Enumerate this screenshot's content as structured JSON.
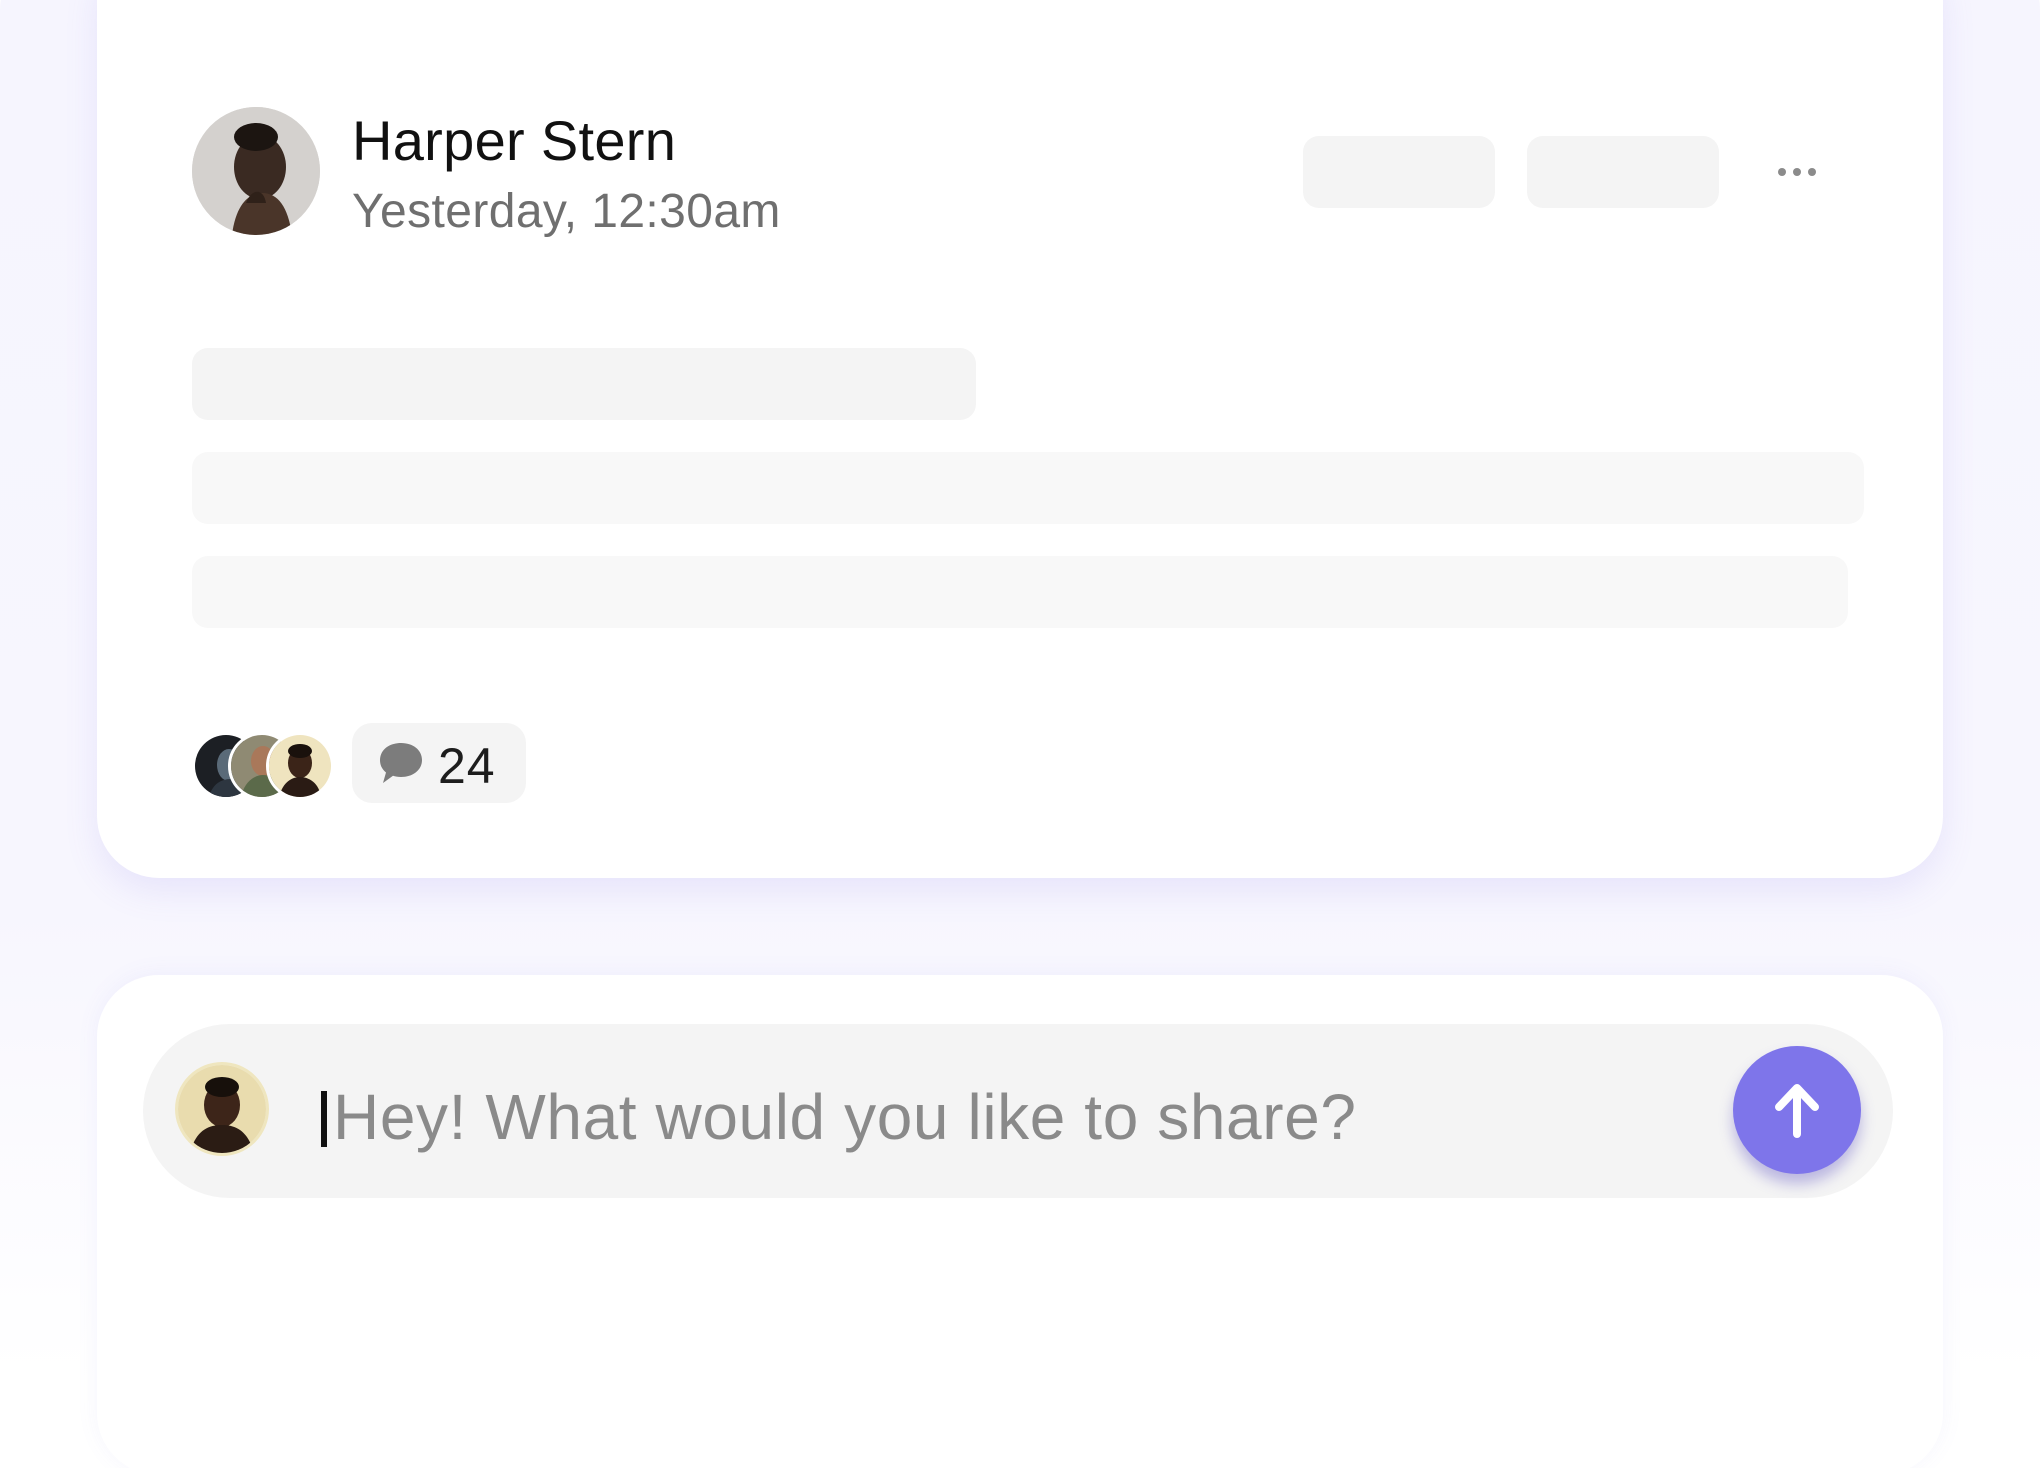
{
  "post": {
    "author_name": "Harper Stern",
    "timestamp": "Yesterday, 12:30am",
    "comment_count": "24",
    "more_icon": "more-horizontal-icon",
    "comment_icon": "chat-bubble-icon"
  },
  "composer": {
    "placeholder": "Hey! What would you like to share?",
    "send_icon": "arrow-up-icon"
  },
  "colors": {
    "accent": "#7e75ea",
    "background": "#f6f5fe",
    "skeleton": "#f4f4f4"
  }
}
